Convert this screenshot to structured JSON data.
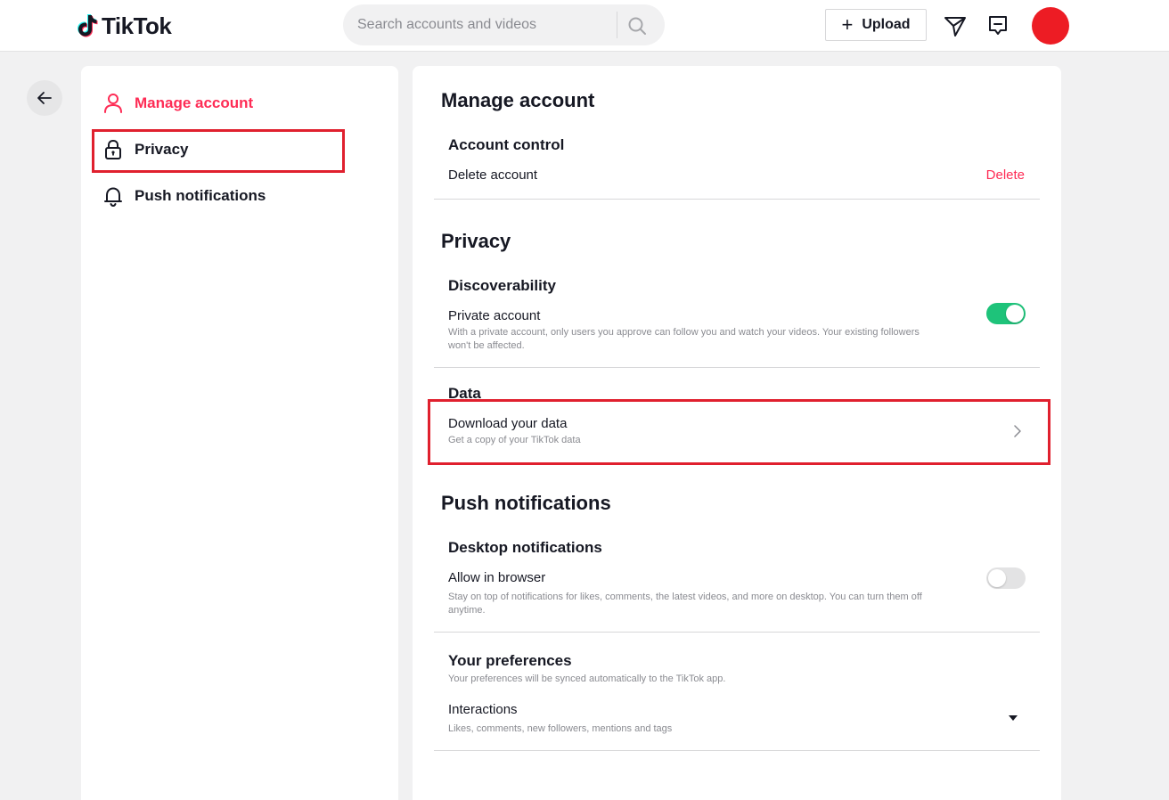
{
  "header": {
    "logo_text": "TikTok",
    "search_placeholder": "Search accounts and videos",
    "upload_label": "Upload",
    "avatar_color": "#ed1c24"
  },
  "sidebar": {
    "items": [
      {
        "label": "Manage account",
        "icon": "person-icon",
        "active": true
      },
      {
        "label": "Privacy",
        "icon": "lock-icon",
        "active": false
      },
      {
        "label": "Push notifications",
        "icon": "bell-icon",
        "active": false
      }
    ]
  },
  "main": {
    "manage_account": {
      "title": "Manage account",
      "account_control": {
        "title": "Account control",
        "delete_row": {
          "label": "Delete account",
          "action": "Delete"
        }
      }
    },
    "privacy": {
      "title": "Privacy",
      "discoverability": {
        "title": "Discoverability",
        "private_account": {
          "label": "Private account",
          "desc_line1": "With a private account, only users you approve can follow you and watch your videos. Your existing followers",
          "desc_line2": "won't be affected.",
          "enabled": true
        }
      },
      "data": {
        "title": "Data",
        "download": {
          "label": "Download your data",
          "desc": "Get a copy of your TikTok data"
        }
      }
    },
    "push_notifications": {
      "title": "Push notifications",
      "desktop": {
        "title": "Desktop notifications",
        "allow_browser": {
          "label": "Allow in browser",
          "desc_line1": "Stay on top of notifications for likes, comments, the latest videos, and more on desktop. You can turn them off",
          "desc_line2": "anytime.",
          "enabled": false
        }
      },
      "preferences": {
        "title": "Your preferences",
        "desc": "Your preferences will be synced automatically to the TikTok app.",
        "interactions": {
          "label": "Interactions",
          "desc": "Likes, comments, new followers, mentions and tags"
        }
      }
    }
  },
  "colors": {
    "accent": "#fe2c55",
    "toggle_on": "#1ec37a",
    "highlight": "#e0202e"
  }
}
